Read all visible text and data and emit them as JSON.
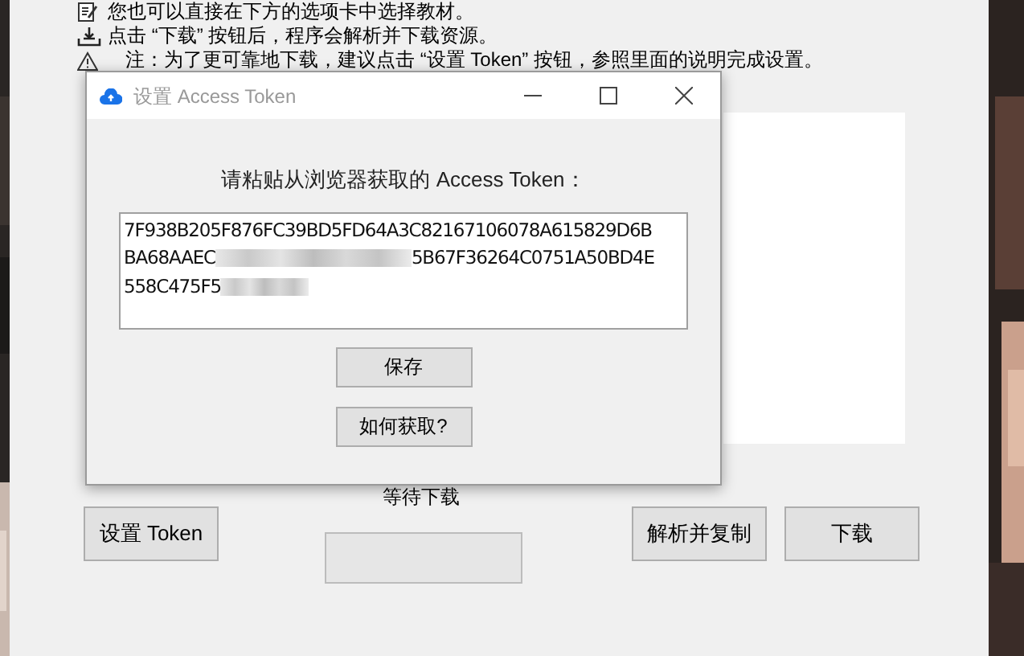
{
  "main": {
    "info_lines": [
      {
        "kind": "edit",
        "text": "您也可以直接在下方的选项卡中选择教材。"
      },
      {
        "kind": "download",
        "text": "点击 “下载” 按钮后，程序会解析并下载资源。"
      },
      {
        "kind": "warning",
        "text": "注：为了更可靠地下载，建议点击 “设置 Token” 按钮，参照里面的说明完成设置。"
      }
    ],
    "status": "等待下载",
    "progress": {
      "level": 0
    },
    "buttons": [
      "设置 Token",
      "解析并复制",
      "下载"
    ]
  },
  "dialog": {
    "title": "设置 Access Token",
    "prompt": "请粘贴从浏览器获取的 Access Token：",
    "token_lines": [
      {
        "visible": "7F938B205F876FC39BD5FD64A3C82167106078A615829D6B",
        "blurred": false
      },
      {
        "visible": "BA68AAEC",
        "blurred": true,
        "after": "5B67F36264C0751A50BD4E"
      },
      {
        "visible": "558C475F5",
        "blurred": true
      }
    ],
    "buttons": [
      "保存",
      "如何获取?"
    ]
  }
}
